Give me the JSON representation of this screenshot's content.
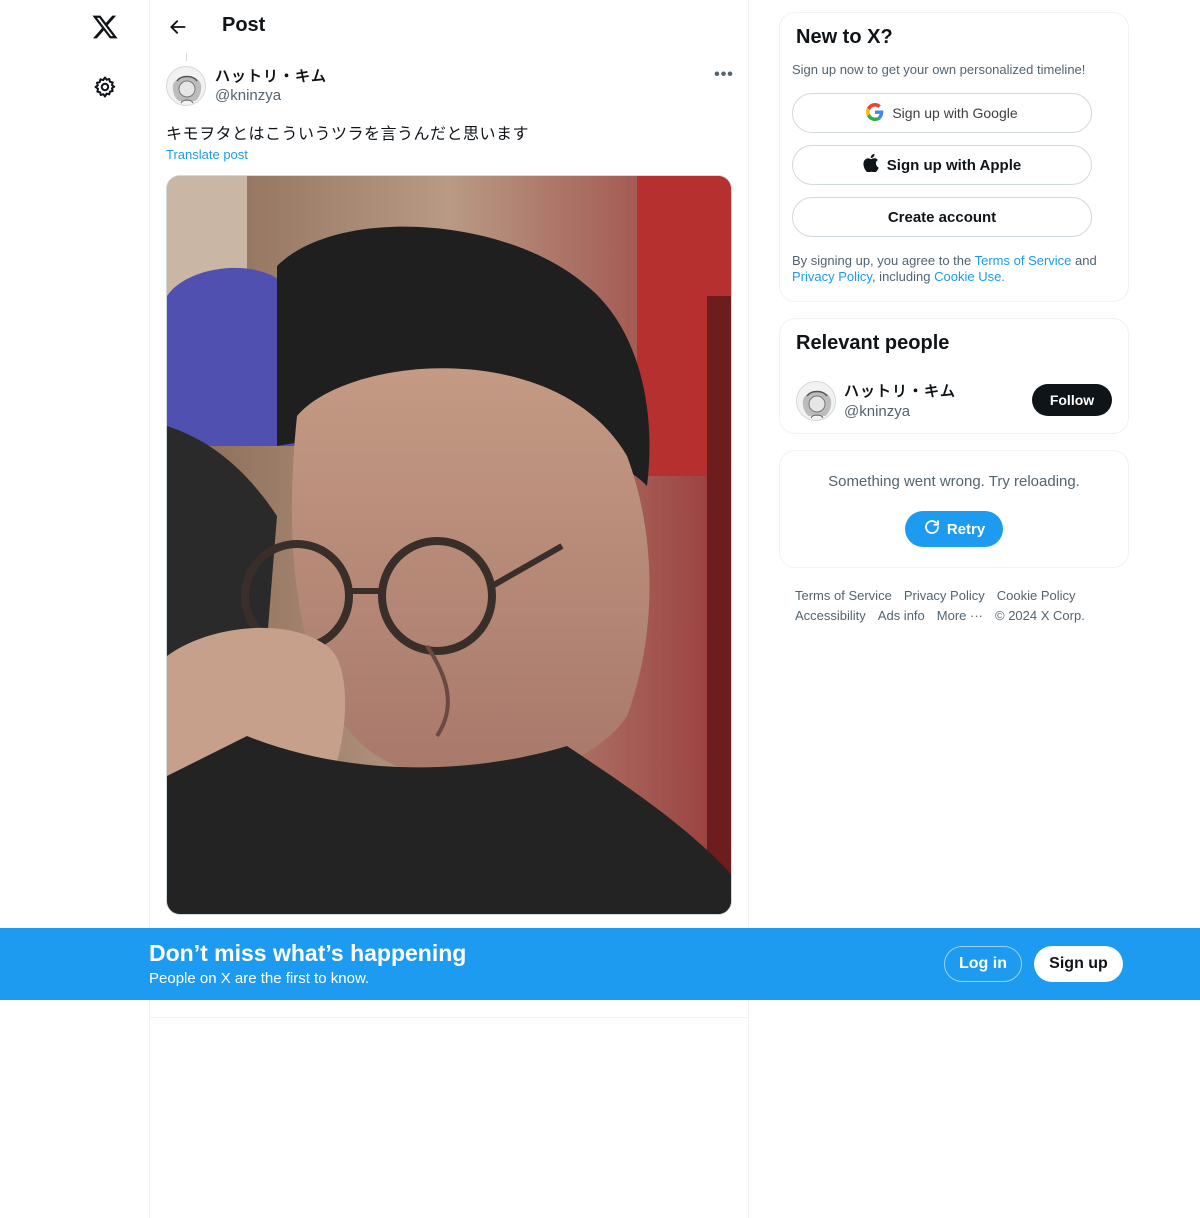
{
  "nav": {
    "logo_icon": "x-logo-icon",
    "settings_icon": "gear-icon"
  },
  "header": {
    "title": "Post"
  },
  "post": {
    "author_name": "ハットリ・キム",
    "author_handle": "@kninzya",
    "text": "キモヲタとはこういうツラを言うんだと思います",
    "translate_label": "Translate post",
    "more_label": "•••"
  },
  "sidebar": {
    "new_to_x": {
      "title": "New to X?",
      "subtitle": "Sign up now to get your own personalized timeline!",
      "google_label": "Sign up with Google",
      "apple_label": "Sign up with Apple",
      "create_label": "Create account",
      "legal_prefix": "By signing up, you agree to the ",
      "terms_link": "Terms of Service",
      "legal_and": " and",
      "privacy_link": "Privacy Policy",
      "legal_including": ", including ",
      "cookie_link": "Cookie Use."
    },
    "relevant_people": {
      "title": "Relevant people",
      "name": "ハットリ・キム",
      "handle": "@kninzya",
      "follow_label": "Follow"
    },
    "error": {
      "message": "Something went wrong. Try reloading.",
      "retry_label": "Retry"
    },
    "footer": {
      "links": [
        "Terms of Service",
        "Privacy Policy",
        "Cookie Policy",
        "Accessibility",
        "Ads info",
        "More ···",
        "© 2024 X Corp."
      ]
    }
  },
  "banner": {
    "title": "Don’t miss what’s happening",
    "subtitle": "People on X are the first to know.",
    "login_label": "Log in",
    "signup_label": "Sign up"
  },
  "colors": {
    "accent": "#1d9bf0",
    "text": "#0f1419",
    "muted": "#536471",
    "border": "#eff3f4"
  }
}
